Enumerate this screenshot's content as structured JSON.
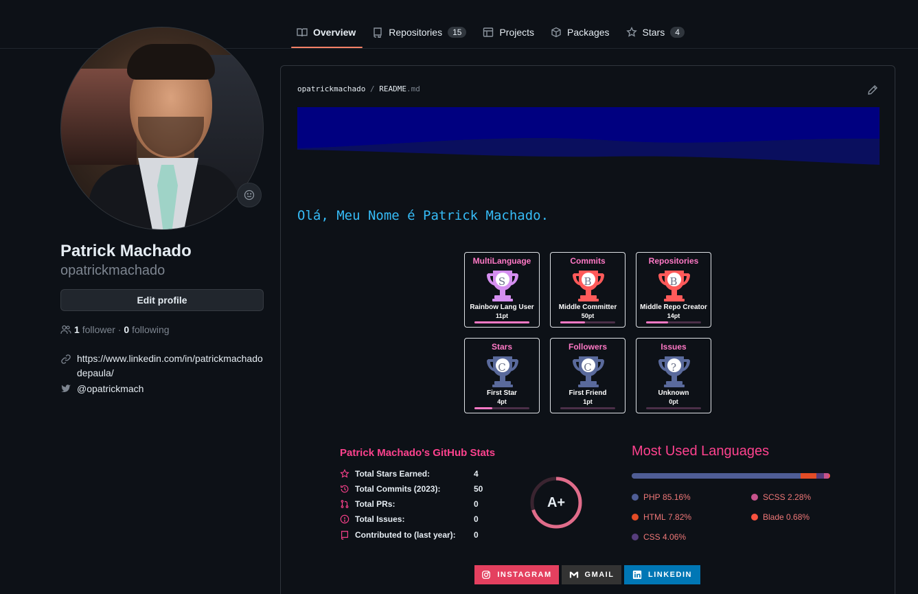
{
  "nav": {
    "tabs": [
      {
        "label": "Overview",
        "icon": "book-icon"
      },
      {
        "label": "Repositories",
        "count": "15",
        "icon": "repo-icon"
      },
      {
        "label": "Projects",
        "icon": "table-icon"
      },
      {
        "label": "Packages",
        "icon": "package-icon"
      },
      {
        "label": "Stars",
        "count": "4",
        "icon": "star-icon"
      }
    ]
  },
  "profile": {
    "full_name": "Patrick Machado",
    "username": "opatrickmachado",
    "edit_label": "Edit profile",
    "followers_count": "1",
    "followers_label": "follower",
    "separator": "·",
    "following_count": "0",
    "following_label": "following",
    "website": "https://www.linkedin.com/in/patrickmachadodepaula/",
    "twitter": "@opatrickmach"
  },
  "readme": {
    "owner": "opatrickmachado",
    "slash": "/",
    "file": "README",
    "ext": ".md",
    "greeting": "Olá, Meu Nome é Patrick Machado.",
    "banner_color": "#000080"
  },
  "trophies": [
    {
      "title": "MultiLanguage",
      "rank": "S",
      "name": "Rainbow Lang User",
      "points": "11pt",
      "progress": 1.0,
      "cup_color": "#d58ff0"
    },
    {
      "title": "Commits",
      "rank": "B",
      "name": "Middle Committer",
      "points": "50pt",
      "progress": 0.45,
      "cup_color": "#ff5a5a"
    },
    {
      "title": "Repositories",
      "rank": "B",
      "name": "Middle Repo Creator",
      "points": "14pt",
      "progress": 0.4,
      "cup_color": "#ff5a5a"
    },
    {
      "title": "Stars",
      "rank": "C",
      "name": "First Star",
      "points": "4pt",
      "progress": 0.33,
      "cup_color": "#5a6a9c"
    },
    {
      "title": "Followers",
      "rank": "C",
      "name": "First Friend",
      "points": "1pt",
      "progress": 0.0,
      "cup_color": "#5a6a9c"
    },
    {
      "title": "Issues",
      "rank": "?",
      "name": "Unknown",
      "points": "0pt",
      "progress": 0.0,
      "cup_color": "#5a6a9c"
    }
  ],
  "stats": {
    "title": "Patrick Machado's GitHub Stats",
    "rows": [
      {
        "label": "Total Stars Earned:",
        "value": "4",
        "icon": "star-icon"
      },
      {
        "label": "Total Commits (2023):",
        "value": "50",
        "icon": "history-icon"
      },
      {
        "label": "Total PRs:",
        "value": "0",
        "icon": "pull-request-icon"
      },
      {
        "label": "Total Issues:",
        "value": "0",
        "icon": "issue-icon"
      },
      {
        "label": "Contributed to (last year):",
        "value": "0",
        "icon": "repo-icon"
      }
    ],
    "grade": "A+",
    "grade_progress": 0.7
  },
  "languages": {
    "title": "Most Used Languages",
    "items": [
      {
        "name": "PHP",
        "percent": "85.16%",
        "value": 85.16,
        "color": "#4F5D95"
      },
      {
        "name": "SCSS",
        "percent": "2.28%",
        "value": 2.28,
        "color": "#c6538c"
      },
      {
        "name": "HTML",
        "percent": "7.82%",
        "value": 7.82,
        "color": "#e34c26"
      },
      {
        "name": "Blade",
        "percent": "0.68%",
        "value": 0.68,
        "color": "#f7523f"
      },
      {
        "name": "CSS",
        "percent": "4.06%",
        "value": 4.06,
        "color": "#563d7c"
      }
    ]
  },
  "badges": [
    {
      "label": "INSTAGRAM",
      "color": "#E4405F",
      "icon": "instagram-icon"
    },
    {
      "label": "GMAIL",
      "color": "#333333",
      "icon": "gmail-icon"
    },
    {
      "label": "LINKEDIN",
      "color": "#0077B5",
      "icon": "linkedin-icon"
    }
  ]
}
